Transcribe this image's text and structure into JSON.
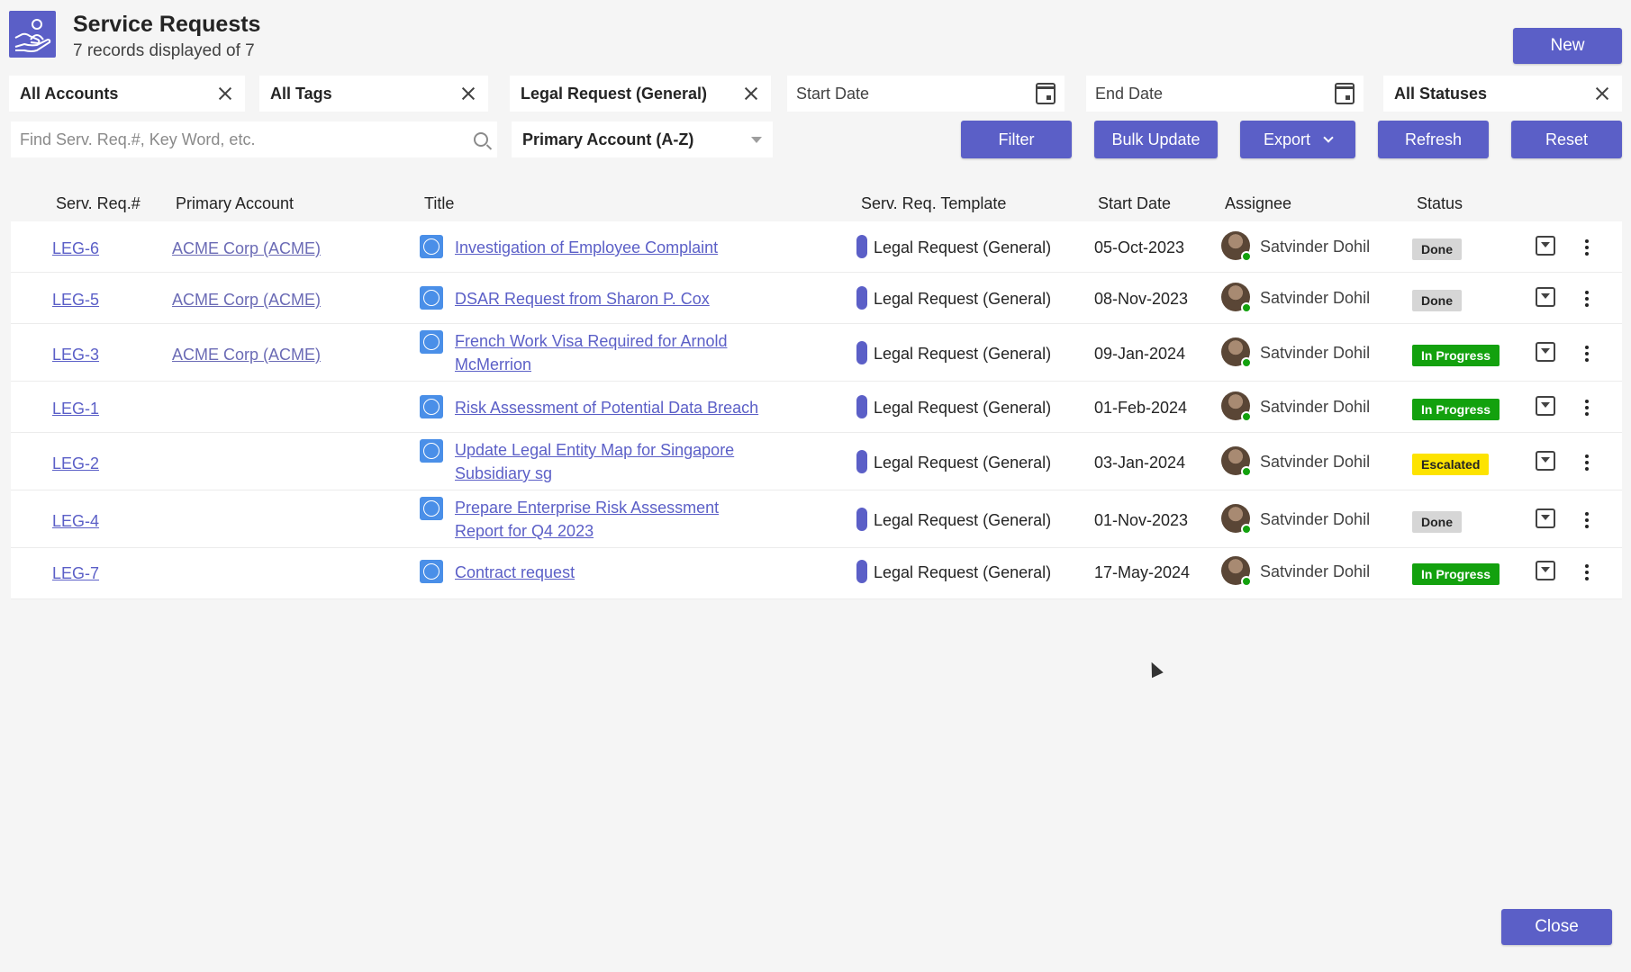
{
  "header": {
    "title": "Service Requests",
    "record_count": "7 records displayed of 7",
    "new_label": "New"
  },
  "filters": {
    "accounts": "All Accounts",
    "tags": "All Tags",
    "template": "Legal Request (General)",
    "start_date": "Start Date",
    "end_date": "End Date",
    "statuses": "All Statuses"
  },
  "search": {
    "placeholder": "Find Serv. Req.#, Key Word, etc.",
    "value": ""
  },
  "sort": {
    "selected": "Primary Account (A-Z)"
  },
  "toolbar": {
    "filter": "Filter",
    "bulk_update": "Bulk Update",
    "export": "Export",
    "refresh": "Refresh",
    "reset": "Reset"
  },
  "table": {
    "columns": [
      "Serv. Req.#",
      "Primary Account",
      "Title",
      "Serv. Req. Template",
      "Start Date",
      "Assignee",
      "Status"
    ],
    "rows": [
      {
        "id": "LEG-6",
        "account": "ACME Corp (ACME)",
        "title": "Investigation of Employee Complaint",
        "template": "Legal Request (General)",
        "start": "05-Oct-2023",
        "assignee": "Satvinder Dohil",
        "status": "Done"
      },
      {
        "id": "LEG-5",
        "account": "ACME Corp (ACME)",
        "title": "DSAR Request from Sharon P. Cox",
        "template": "Legal Request (General)",
        "start": "08-Nov-2023",
        "assignee": "Satvinder Dohil",
        "status": "Done"
      },
      {
        "id": "LEG-3",
        "account": "ACME Corp (ACME)",
        "title": "French Work Visa Required for Arnold McMerrion",
        "template": "Legal Request (General)",
        "start": "09-Jan-2024",
        "assignee": "Satvinder Dohil",
        "status": "In Progress"
      },
      {
        "id": "LEG-1",
        "account": "",
        "title": "Risk Assessment of Potential Data Breach",
        "template": "Legal Request (General)",
        "start": "01-Feb-2024",
        "assignee": "Satvinder Dohil",
        "status": "In Progress"
      },
      {
        "id": "LEG-2",
        "account": "",
        "title": "Update Legal Entity Map for Singapore Subsidiary sg",
        "template": "Legal Request (General)",
        "start": "03-Jan-2024",
        "assignee": "Satvinder Dohil",
        "status": "Escalated"
      },
      {
        "id": "LEG-4",
        "account": "",
        "title": "Prepare Enterprise Risk Assessment Report for Q4 2023",
        "template": "Legal Request (General)",
        "start": "01-Nov-2023",
        "assignee": "Satvinder Dohil",
        "status": "Done"
      },
      {
        "id": "LEG-7",
        "account": "",
        "title": "Contract request",
        "template": "Legal Request (General)",
        "start": "17-May-2024",
        "assignee": "Satvinder Dohil",
        "status": "In Progress"
      }
    ]
  },
  "footer": {
    "close_label": "Close"
  },
  "colors": {
    "accent": "#5b5fc7",
    "done": "#d6d6d6",
    "in_progress": "#13a10e",
    "escalated": "#fde300"
  },
  "icons": {
    "app": "hand-holding-person-icon",
    "clear": "close-icon",
    "calendar": "calendar-icon",
    "search": "search-icon",
    "row_type": "question-icon",
    "expand": "dropdown-box-icon",
    "more": "more-vertical-icon"
  }
}
